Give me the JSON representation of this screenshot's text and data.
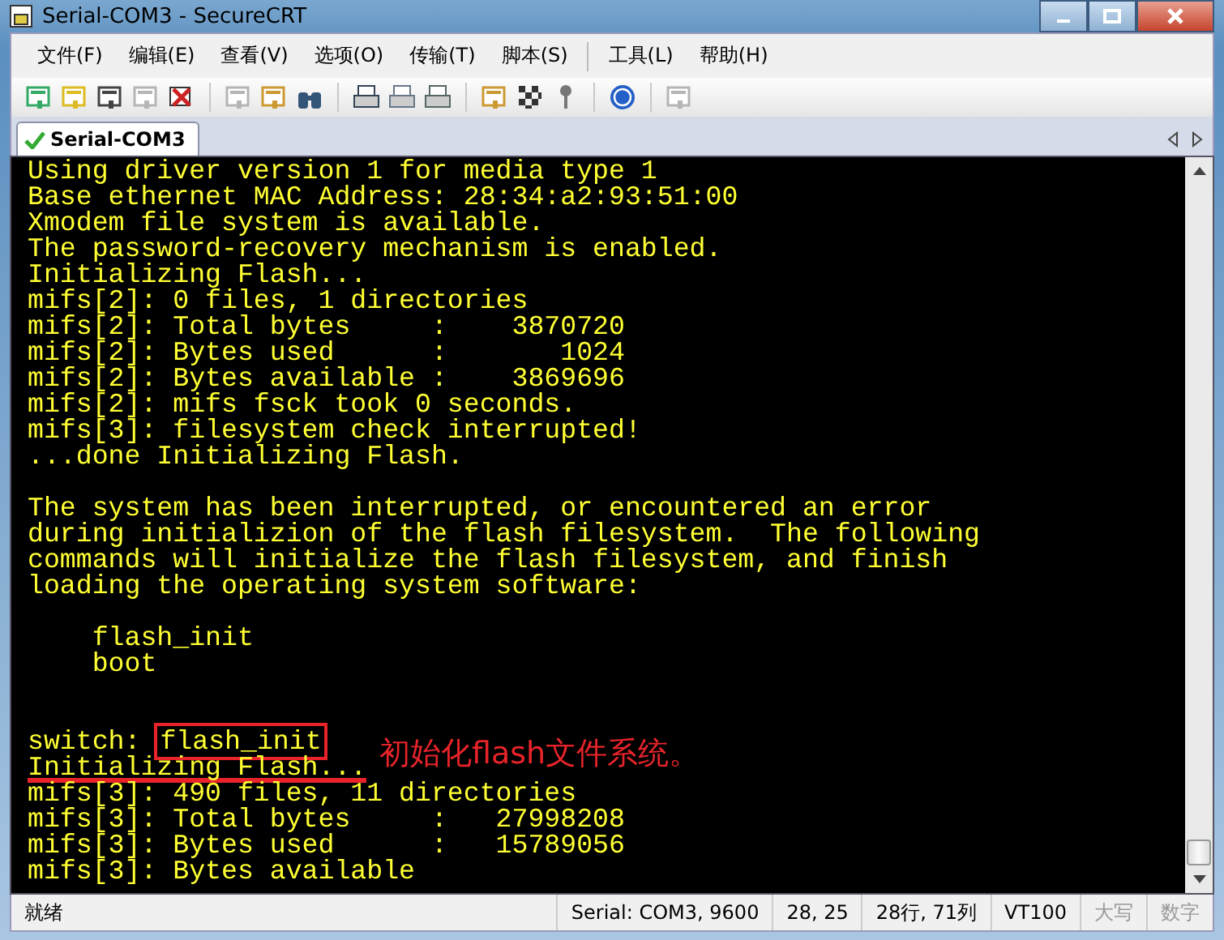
{
  "window": {
    "title": "Serial-COM3 - SecureCRT"
  },
  "menu": [
    {
      "label": "文件(F)"
    },
    {
      "label": "编辑(E)"
    },
    {
      "label": "查看(V)"
    },
    {
      "label": "选项(O)"
    },
    {
      "label": "传输(T)"
    },
    {
      "label": "脚本(S)",
      "separator_after": true
    },
    {
      "label": "工具(L)"
    },
    {
      "label": "帮助(H)"
    }
  ],
  "toolbar_groups": [
    [
      {
        "disabled": false
      },
      {
        "disabled": false
      },
      {
        "disabled": false
      },
      {
        "disabled": true
      },
      {
        "disabled": false
      }
    ],
    [
      {
        "disabled": true
      },
      {
        "disabled": false
      },
      {
        "disabled": false
      }
    ],
    [
      {
        "disabled": false
      },
      {
        "disabled": false
      },
      {
        "disabled": false
      }
    ],
    [
      {
        "disabled": false
      },
      {
        "disabled": false
      },
      {
        "disabled": false
      }
    ],
    [
      {
        "disabled": false
      }
    ],
    [
      {
        "disabled": true
      }
    ]
  ],
  "tabs": [
    {
      "label": "Serial-COM3",
      "selected": true,
      "connected": true
    }
  ],
  "terminal": {
    "lines": [
      {
        "kind": "plain",
        "text": "Using driver version 1 for media type 1"
      },
      {
        "kind": "plain",
        "text": "Base ethernet MAC Address: 28:34:a2:93:51:00"
      },
      {
        "kind": "plain",
        "text": "Xmodem file system is available."
      },
      {
        "kind": "plain",
        "text": "The password-recovery mechanism is enabled."
      },
      {
        "kind": "plain",
        "text": "Initializing Flash..."
      },
      {
        "kind": "plain",
        "text": "mifs[2]: 0 files, 1 directories"
      },
      {
        "kind": "plain",
        "text": "mifs[2]: Total bytes     :    3870720"
      },
      {
        "kind": "plain",
        "text": "mifs[2]: Bytes used      :       1024"
      },
      {
        "kind": "plain",
        "text": "mifs[2]: Bytes available :    3869696"
      },
      {
        "kind": "plain",
        "text": "mifs[2]: mifs fsck took 0 seconds."
      },
      {
        "kind": "plain",
        "text": "mifs[3]: filesystem check interrupted!"
      },
      {
        "kind": "plain",
        "text": "...done Initializing Flash."
      },
      {
        "kind": "blank"
      },
      {
        "kind": "plain",
        "text": "The system has been interrupted, or encountered an error"
      },
      {
        "kind": "plain",
        "text": "during initializion of the flash filesystem.  The following"
      },
      {
        "kind": "plain",
        "text": "commands will initialize the flash filesystem, and finish"
      },
      {
        "kind": "plain",
        "text": "loading the operating system software:"
      },
      {
        "kind": "blank"
      },
      {
        "kind": "plain",
        "text": "    flash_init"
      },
      {
        "kind": "plain",
        "text": "    boot"
      },
      {
        "kind": "blank"
      },
      {
        "kind": "blank"
      },
      {
        "kind": "command",
        "prompt": "switch:",
        "text": "flash_init"
      },
      {
        "kind": "underlined",
        "text": "Initializing Flash...",
        "note": "初始化flash文件系统。"
      },
      {
        "kind": "plain",
        "text": "mifs[3]: 490 files, 11 directories"
      },
      {
        "kind": "plain",
        "text": "mifs[3]: Total bytes     :   27998208"
      },
      {
        "kind": "plain",
        "text": "mifs[3]: Bytes used      :   15789056"
      },
      {
        "kind": "plain",
        "text": "mifs[3]: Bytes available"
      }
    ]
  },
  "status_bar": [
    {
      "text": "就绪",
      "disabled": false
    },
    {
      "text": "Serial: COM3, 9600",
      "disabled": false
    },
    {
      "text": "28,  25",
      "disabled": false
    },
    {
      "text": "28行, 71列",
      "disabled": false
    },
    {
      "text": "VT100",
      "disabled": false
    },
    {
      "text": "大写",
      "disabled": true
    },
    {
      "text": "数字",
      "disabled": true
    }
  ]
}
